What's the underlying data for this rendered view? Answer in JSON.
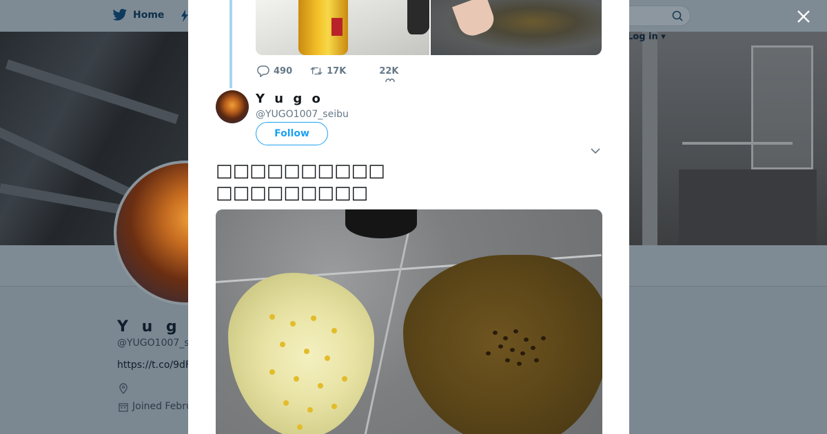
{
  "nav": {
    "home_label": "Home",
    "login_label": "Log in ▾"
  },
  "profile": {
    "name": "Y u g o",
    "handle": "@YUGO1007_s",
    "link": "https://t.co/9dF",
    "joined": "Joined Febru"
  },
  "modal": {
    "prev_tweet_stats": {
      "replies": "490",
      "retweets": "17K",
      "likes": "22K"
    },
    "tweet": {
      "user_name": "Y u g o",
      "user_handle": "@YUGO1007_seibu",
      "follow_label": "Follow",
      "text_lines": [
        "□□□□□□□□□□",
        "□□□□□□□□□"
      ]
    }
  },
  "colors": {
    "accent": "#1da1f2",
    "thread_line": "#a8d4ee",
    "overlay": "#7b8791"
  }
}
